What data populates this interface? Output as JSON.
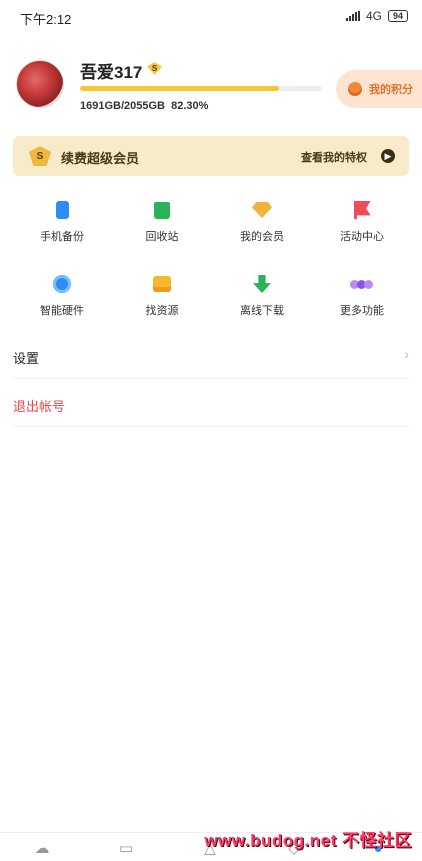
{
  "status_bar": {
    "time": "下午2:12",
    "network": "4G",
    "battery": "94"
  },
  "profile": {
    "username": "吾爱317",
    "vip_badge": "S",
    "storage_text": "1691GB/2055GB",
    "storage_percent": "82.30%",
    "storage_fraction": 0.823,
    "points_label": "我的积分"
  },
  "vip_bar": {
    "icon_text": "S",
    "title": "续费超级会员",
    "link": "查看我的特权"
  },
  "grid": [
    {
      "label": "手机备份",
      "icon": "phone-icon"
    },
    {
      "label": "回收站",
      "icon": "trash-icon"
    },
    {
      "label": "我的会员",
      "icon": "diamond-icon"
    },
    {
      "label": "活动中心",
      "icon": "flag-icon"
    },
    {
      "label": "智能硬件",
      "icon": "hardware-icon"
    },
    {
      "label": "找资源",
      "icon": "box-icon"
    },
    {
      "label": "离线下载",
      "icon": "download-icon"
    },
    {
      "label": "更多功能",
      "icon": "more-icon"
    }
  ],
  "settings": {
    "label": "设置"
  },
  "logout": {
    "label": "退出帐号",
    "color": "#e8474c"
  },
  "watermark": "www.budog.net 不怪社区",
  "colors": {
    "accent_yellow": "#f6c72e",
    "points_orange": "#e0722c"
  }
}
